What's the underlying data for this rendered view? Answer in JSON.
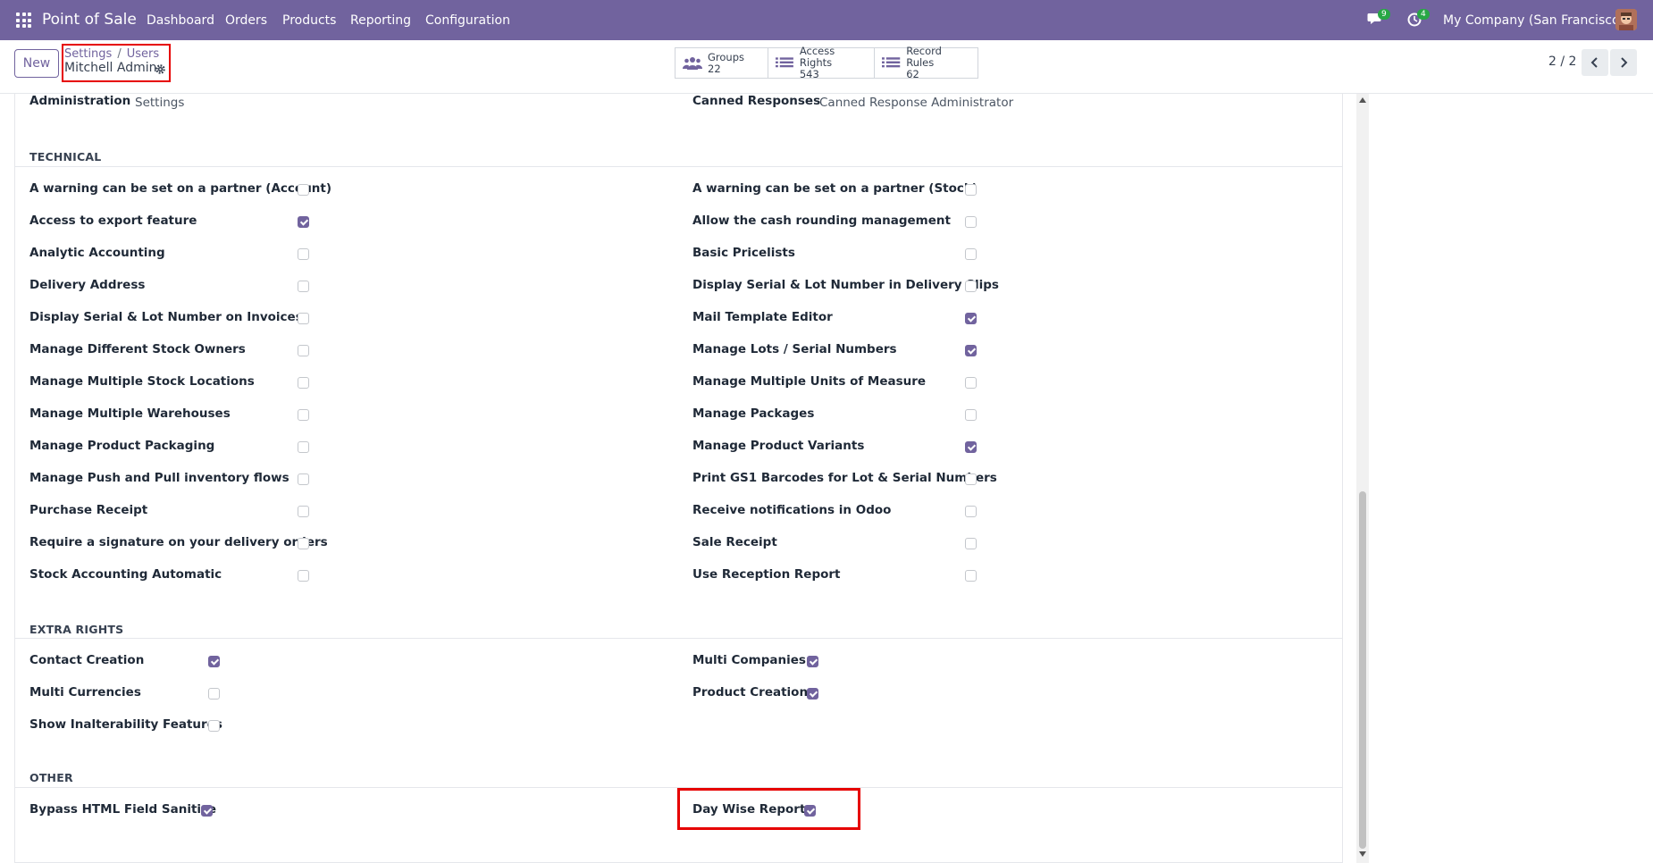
{
  "topbar": {
    "app_name": "Point of Sale",
    "menu": [
      "Dashboard",
      "Orders",
      "Products",
      "Reporting",
      "Configuration"
    ],
    "chat_badge": "9",
    "activity_badge": "4",
    "company": "My Company (San Francisco)"
  },
  "control": {
    "new_label": "New",
    "breadcrumb_parent": "Settings",
    "breadcrumb_sep": "/",
    "breadcrumb_current": "Users",
    "record_title": "Mitchell Admin",
    "stats": [
      {
        "label": "Groups",
        "count": "22",
        "icon": "users-icon"
      },
      {
        "label": "Access Rights",
        "count": "543",
        "icon": "list-icon"
      },
      {
        "label": "Record Rules",
        "count": "62",
        "icon": "list-icon"
      }
    ],
    "pager": "2 / 2"
  },
  "top_fields": {
    "admin_label": "Administration",
    "admin_value": "Settings",
    "canned_label": "Canned Responses",
    "canned_value": "Canned Response Administrator"
  },
  "technical": {
    "title": "TECHNICAL",
    "left": [
      {
        "label": "A warning can be set on a partner (Account)",
        "checked": false
      },
      {
        "label": "Access to export feature",
        "checked": true
      },
      {
        "label": "Analytic Accounting",
        "checked": false
      },
      {
        "label": "Delivery Address",
        "checked": false
      },
      {
        "label": "Display Serial & Lot Number on Invoices",
        "checked": false
      },
      {
        "label": "Manage Different Stock Owners",
        "checked": false
      },
      {
        "label": "Manage Multiple Stock Locations",
        "checked": false
      },
      {
        "label": "Manage Multiple Warehouses",
        "checked": false
      },
      {
        "label": "Manage Product Packaging",
        "checked": false
      },
      {
        "label": "Manage Push and Pull inventory flows",
        "checked": false
      },
      {
        "label": "Purchase Receipt",
        "checked": false
      },
      {
        "label": "Require a signature on your delivery orders",
        "checked": false
      },
      {
        "label": "Stock Accounting Automatic",
        "checked": false
      }
    ],
    "right": [
      {
        "label": "A warning can be set on a partner (Stock)",
        "checked": false
      },
      {
        "label": "Allow the cash rounding management",
        "checked": false
      },
      {
        "label": "Basic Pricelists",
        "checked": false
      },
      {
        "label": "Display Serial & Lot Number in Delivery Slips",
        "checked": false
      },
      {
        "label": "Mail Template Editor",
        "checked": true
      },
      {
        "label": "Manage Lots / Serial Numbers",
        "checked": true
      },
      {
        "label": "Manage Multiple Units of Measure",
        "checked": false
      },
      {
        "label": "Manage Packages",
        "checked": false
      },
      {
        "label": "Manage Product Variants",
        "checked": true
      },
      {
        "label": "Print GS1 Barcodes for Lot & Serial Numbers",
        "checked": false
      },
      {
        "label": "Receive notifications in Odoo",
        "checked": false
      },
      {
        "label": "Sale Receipt",
        "checked": false
      },
      {
        "label": "Use Reception Report",
        "checked": false
      }
    ]
  },
  "extra": {
    "title": "EXTRA RIGHTS",
    "left": [
      {
        "label": "Contact Creation",
        "checked": true
      },
      {
        "label": "Multi Currencies",
        "checked": false
      },
      {
        "label": "Show Inalterability Features",
        "checked": false
      }
    ],
    "right": [
      {
        "label": "Multi Companies",
        "checked": true
      },
      {
        "label": "Product Creation",
        "checked": true
      }
    ]
  },
  "other": {
    "title": "OTHER",
    "left": [
      {
        "label": "Bypass HTML Field Sanitize",
        "checked": true
      }
    ],
    "right": [
      {
        "label": "Day Wise Report",
        "checked": true
      }
    ]
  },
  "colors": {
    "brand": "#71639e",
    "highlight": "#e60000",
    "badge": "#28a745"
  }
}
